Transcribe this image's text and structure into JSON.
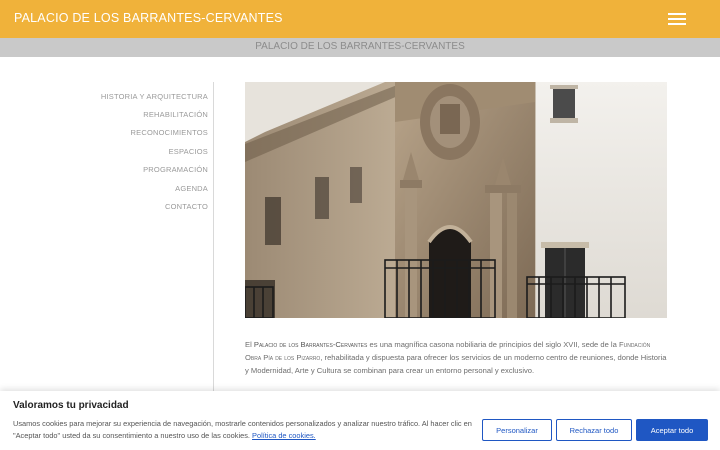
{
  "header": {
    "site_title": "PALACIO DE LOS BARRANTES-CERVANTES"
  },
  "subheader": {
    "page_title": "PALACIO DE LOS BARRANTES-CERVANTES"
  },
  "sidebar": {
    "items": [
      {
        "label": "HISTORIA Y ARQUITECTURA"
      },
      {
        "label": "REHABILITACIÓN"
      },
      {
        "label": "RECONOCIMIENTOS"
      },
      {
        "label": "ESPACIOS"
      },
      {
        "label": "PROGRAMACIÓN"
      },
      {
        "label": "AGENDA"
      },
      {
        "label": "CONTACTO"
      }
    ]
  },
  "main": {
    "intro_el": "El ",
    "palace_name": "Palacio de los Barrantes-Cervantes",
    "text_1": " es una magnífica casona nobiliaria de principios del siglo XVII, sede de la ",
    "foundation_name": "Fundación Obra Pía de los Pizarro",
    "text_2": ", rehabilitada y dispuesta para ofrecer los servicios de un moderno centro de reuniones, donde Historia y Modernidad, Arte y Cultura se combinan para crear un entorno personal y exclusivo."
  },
  "cookie_banner": {
    "title": "Valoramos tu privacidad",
    "text": "Usamos cookies para mejorar su experiencia de navegación, mostrarle contenidos personalizados y analizar nuestro tráfico. Al hacer clic en \"Aceptar todo\" usted da su consentimiento a nuestro uso de las cookies. ",
    "link_label": "Política de cookies.",
    "customize_label": "Personalizar",
    "reject_label": "Rechazar todo",
    "accept_label": "Aceptar todo"
  },
  "colors": {
    "header_bg": "#f0b23a",
    "subheader_bg": "#c9c9c9",
    "button_blue": "#1f57c3"
  },
  "icons": {
    "menu": "hamburger-icon"
  }
}
